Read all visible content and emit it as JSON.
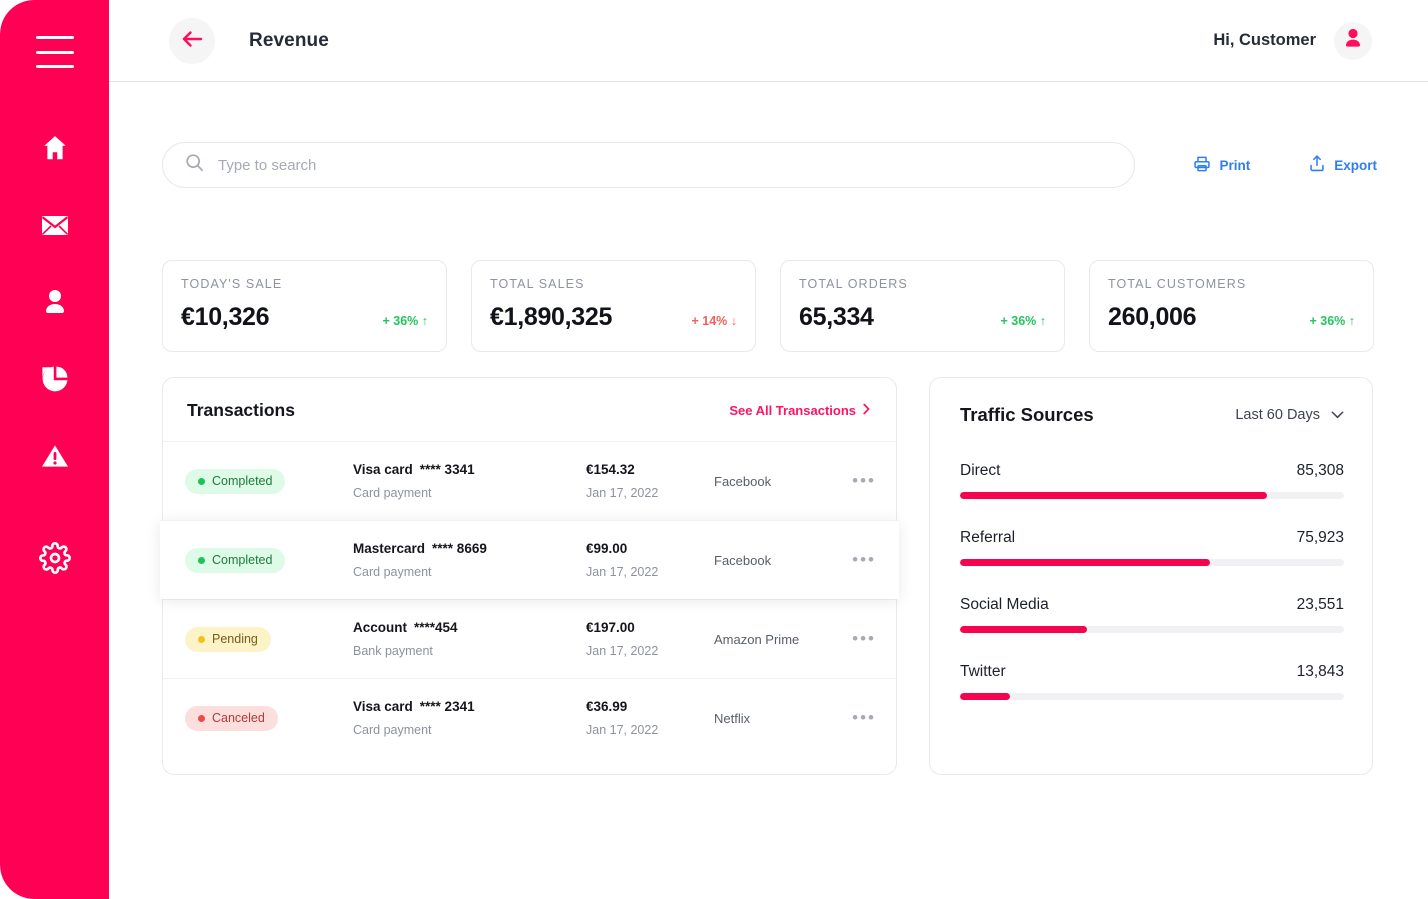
{
  "sidebar": {
    "menu_icon": "hamburger-menu-icon",
    "items": [
      {
        "icon": "home-icon",
        "name": "home"
      },
      {
        "icon": "mail-icon",
        "name": "mail"
      },
      {
        "icon": "user-icon",
        "name": "user"
      },
      {
        "icon": "pie-chart-icon",
        "name": "analytics"
      },
      {
        "icon": "alert-triangle-icon",
        "name": "alerts"
      }
    ],
    "bottom": [
      {
        "icon": "gear-icon",
        "name": "settings"
      }
    ],
    "color": "#FF0055"
  },
  "header": {
    "back_icon": "arrow-left-icon",
    "title": "Revenue",
    "greeting": "Hi, Customer",
    "avatar_icon": "user-avatar-icon"
  },
  "search": {
    "placeholder": "Type to search",
    "value": "",
    "icon": "search-icon"
  },
  "toolbar": {
    "print_label": "Print",
    "print_icon": "printer-icon",
    "export_label": "Export",
    "export_icon": "upload-icon",
    "link_color": "#2f7ef0"
  },
  "stats": [
    {
      "label": "TODAY'S SALE",
      "value": "€10,326",
      "delta": "+ 36% ↑",
      "direction": "up"
    },
    {
      "label": "TOTAL SALES",
      "value": "€1,890,325",
      "delta": "+ 14% ↓",
      "direction": "down"
    },
    {
      "label": "TOTAL ORDERS",
      "value": "65,334",
      "delta": "+ 36% ↑",
      "direction": "up"
    },
    {
      "label": "TOTAL CUSTOMERS",
      "value": "260,006",
      "delta": "+ 36% ↑",
      "direction": "up"
    }
  ],
  "transactions": {
    "title": "Transactions",
    "see_all_label": "See All Transactions",
    "see_all_icon": "chevron-right-icon",
    "more_glyph": "•••",
    "rows": [
      {
        "status": "Completed",
        "status_type": "completed",
        "method": "Visa card",
        "mask": "**** 3341",
        "method_sub": "Card payment",
        "amount": "€154.32",
        "date": "Jan 17, 2022",
        "source": "Facebook",
        "elevated": false
      },
      {
        "status": "Completed",
        "status_type": "completed",
        "method": "Mastercard",
        "mask": "**** 8669",
        "method_sub": "Card payment",
        "amount": "€99.00",
        "date": "Jan 17, 2022",
        "source": "Facebook",
        "elevated": true
      },
      {
        "status": "Pending",
        "status_type": "pending",
        "method": "Account",
        "mask": "****454",
        "method_sub": "Bank payment",
        "amount": "€197.00",
        "date": "Jan 17, 2022",
        "source": "Amazon Prime",
        "elevated": false
      },
      {
        "status": "Canceled",
        "status_type": "canceled",
        "method": "Visa card",
        "mask": "**** 2341",
        "method_sub": "Card payment",
        "amount": "€36.99",
        "date": "Jan 17, 2022",
        "source": "Netflix",
        "elevated": false
      }
    ]
  },
  "traffic_sources": {
    "title": "Traffic Sources",
    "range_label": "Last 60 Days",
    "range_icon": "chevron-down-icon",
    "bar_color": "#f5054f",
    "track_color": "#f1f1f3"
  },
  "chart_data": {
    "type": "bar",
    "title": "Traffic Sources",
    "subtitle": "Last 60 Days",
    "orientation": "horizontal",
    "categories": [
      "Direct",
      "Referral",
      "Social Media",
      "Twitter"
    ],
    "values": [
      85308,
      75923,
      23551,
      13843
    ],
    "value_labels": [
      "85,308",
      "75,923",
      "23,551",
      "13,843"
    ],
    "fill_percent": [
      80,
      65,
      33,
      13
    ],
    "xlabel": "",
    "ylabel": "",
    "grid": false,
    "legend": "none"
  }
}
